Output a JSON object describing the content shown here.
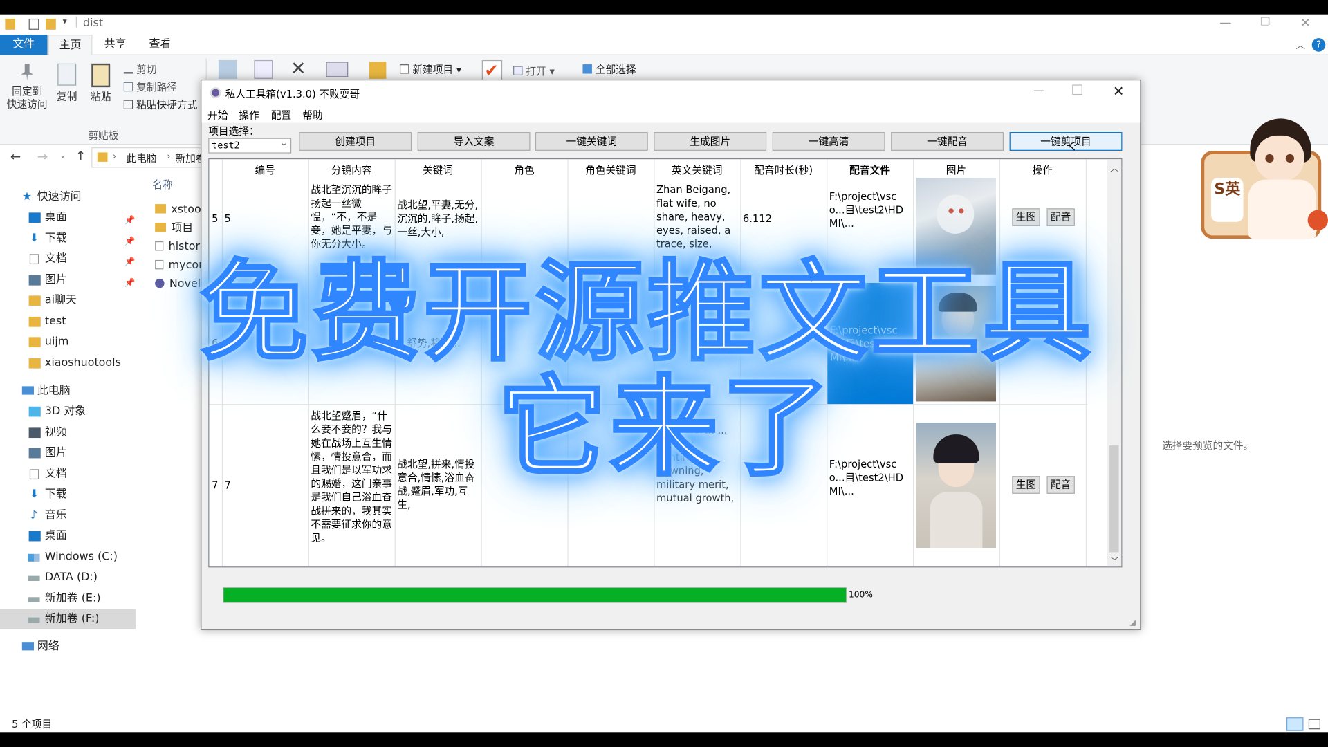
{
  "explorer": {
    "title": "dist",
    "tabs": [
      "文件",
      "主页",
      "共享",
      "查看"
    ],
    "ribbon": {
      "pin_label": "固定到\n快速访问",
      "copy": "复制",
      "paste": "粘贴",
      "cut": "剪切",
      "copy_path": "复制路径",
      "paste_shortcut": "粘贴快捷方式",
      "group_clipboard": "剪贴板",
      "new_item": "新建项目",
      "open": "打开",
      "select_all": "全部选择"
    },
    "breadcrumb": [
      "此电脑",
      "新加卷"
    ],
    "column_name": "名称",
    "quick_access": "快速访问",
    "nav": [
      "桌面",
      "下载",
      "文档",
      "图片",
      "ai聊天",
      "test",
      "uijm",
      "xiaoshuotools"
    ],
    "this_pc": "此电脑",
    "pc_items": [
      "3D 对象",
      "视频",
      "图片",
      "文档",
      "下载",
      "音乐",
      "桌面",
      "Windows (C:)",
      "DATA (D:)",
      "新加卷 (E:)",
      "新加卷 (F:)"
    ],
    "network": "网络",
    "files": [
      "xstoo",
      "项目",
      "histor",
      "mycon",
      "Novel"
    ],
    "preview_hint": "选择要预览的文件。",
    "status": "5 个项目",
    "colors": {
      "ribbon_file_tab": "#1979ca",
      "selected_nav": "#cce8ff"
    }
  },
  "dialog": {
    "title": "私人工具箱(v1.3.0) 不败耍哥",
    "menu": [
      "开始",
      "操作",
      "配置",
      "帮助"
    ],
    "project_label": "项目选择：",
    "project_value": "test2",
    "buttons": [
      "创建项目",
      "导入文案",
      "一键关键词",
      "生成图片",
      "一键高清",
      "一键配音",
      "一键剪项目"
    ],
    "columns": [
      "编号",
      "分镜内容",
      "关键词",
      "角色",
      "角色关键词",
      "英文关键词",
      "配音时长(秒)",
      "配音文件",
      "图片",
      "操作"
    ],
    "rows": [
      {
        "idx": "5",
        "no": "5",
        "content": "战北望沉沉的眸子扬起一丝微愠，“不，不是妾，她是平妻，与你无分大小。",
        "keywords": "战北望,平妻,无分,沉沉的,眸子,扬起,一丝,大小,",
        "role": "",
        "role_keywords": "",
        "en_keywords": "Zhan Beigang, flat wife, no share, heavy, eyes, raised, a trace, size,",
        "duration": "6.112",
        "audio_file": "F:\\project\\vsco...目\\test2\\HDMI\\...",
        "gen_btn": "生图",
        "dub_btn": "配音"
      },
      {
        "idx": "6",
        "no": "",
        "content": "",
        "keywords": "...舒势,将军...",
        "role": "",
        "role_keywords": "",
        "en_keywords": "",
        "duration": "",
        "audio_file": "F:\\project\\vsco...目\\test2\\HDMI\\...",
        "gen_btn": "",
        "dub_btn": ""
      },
      {
        "idx": "7",
        "no": "7",
        "content": "战北望蹙眉，“什么妾不妾的？我与她在战场上互生情愫，情投意合，而且我们是以军功求的赐婚，这门亲事是我们自己浴血奋战拼来的，我其实不需要征求你的意见。",
        "keywords": "战北望,拼来,情投意合,情愫,浴血奋战,蹙眉,军功,互生,",
        "role": "",
        "role_keywords": "",
        "en_keywords": "...the North ... fiercely fighting, frowning, military merit, mutual growth,",
        "duration": "",
        "audio_file": "F:\\project\\vsco...目\\test2\\HDMI\\...",
        "gen_btn": "生图",
        "dub_btn": "配音"
      }
    ],
    "progress": 1.0,
    "progress_text": "100%",
    "colors": {
      "progress": "#06b025",
      "selected_cell": "#0078d7"
    }
  },
  "overlay": {
    "line1": "免费开源推文工具",
    "line2": "它来了",
    "sticker_text": "S英"
  }
}
